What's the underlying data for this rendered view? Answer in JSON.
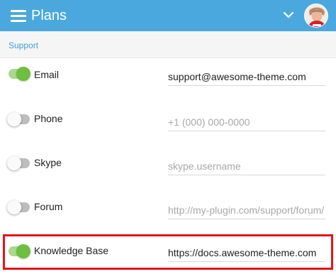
{
  "topbar": {
    "title": "Plans",
    "menu_icon": "hamburger-menu-icon",
    "dropdown_icon": "chevron-down-icon",
    "accent_color": "#4aa8de"
  },
  "section": {
    "label": "Support",
    "label_color": "#3d9fd9"
  },
  "rows": [
    {
      "label": "Email",
      "enabled": true,
      "value": "support@awesome-theme.com",
      "placeholder": ""
    },
    {
      "label": "Phone",
      "enabled": false,
      "value": "",
      "placeholder": "+1 (000) 000-0000"
    },
    {
      "label": "Skype",
      "enabled": false,
      "value": "",
      "placeholder": "skype.username"
    },
    {
      "label": "Forum",
      "enabled": false,
      "value": "",
      "placeholder": "http://my-plugin.com/support/forum/"
    },
    {
      "label": "Knowledge Base",
      "enabled": true,
      "value": "https://docs.awesome-theme.com",
      "placeholder": ""
    }
  ],
  "colors": {
    "toggle_on": "#6cbf3f",
    "highlight": "#e0141a"
  }
}
